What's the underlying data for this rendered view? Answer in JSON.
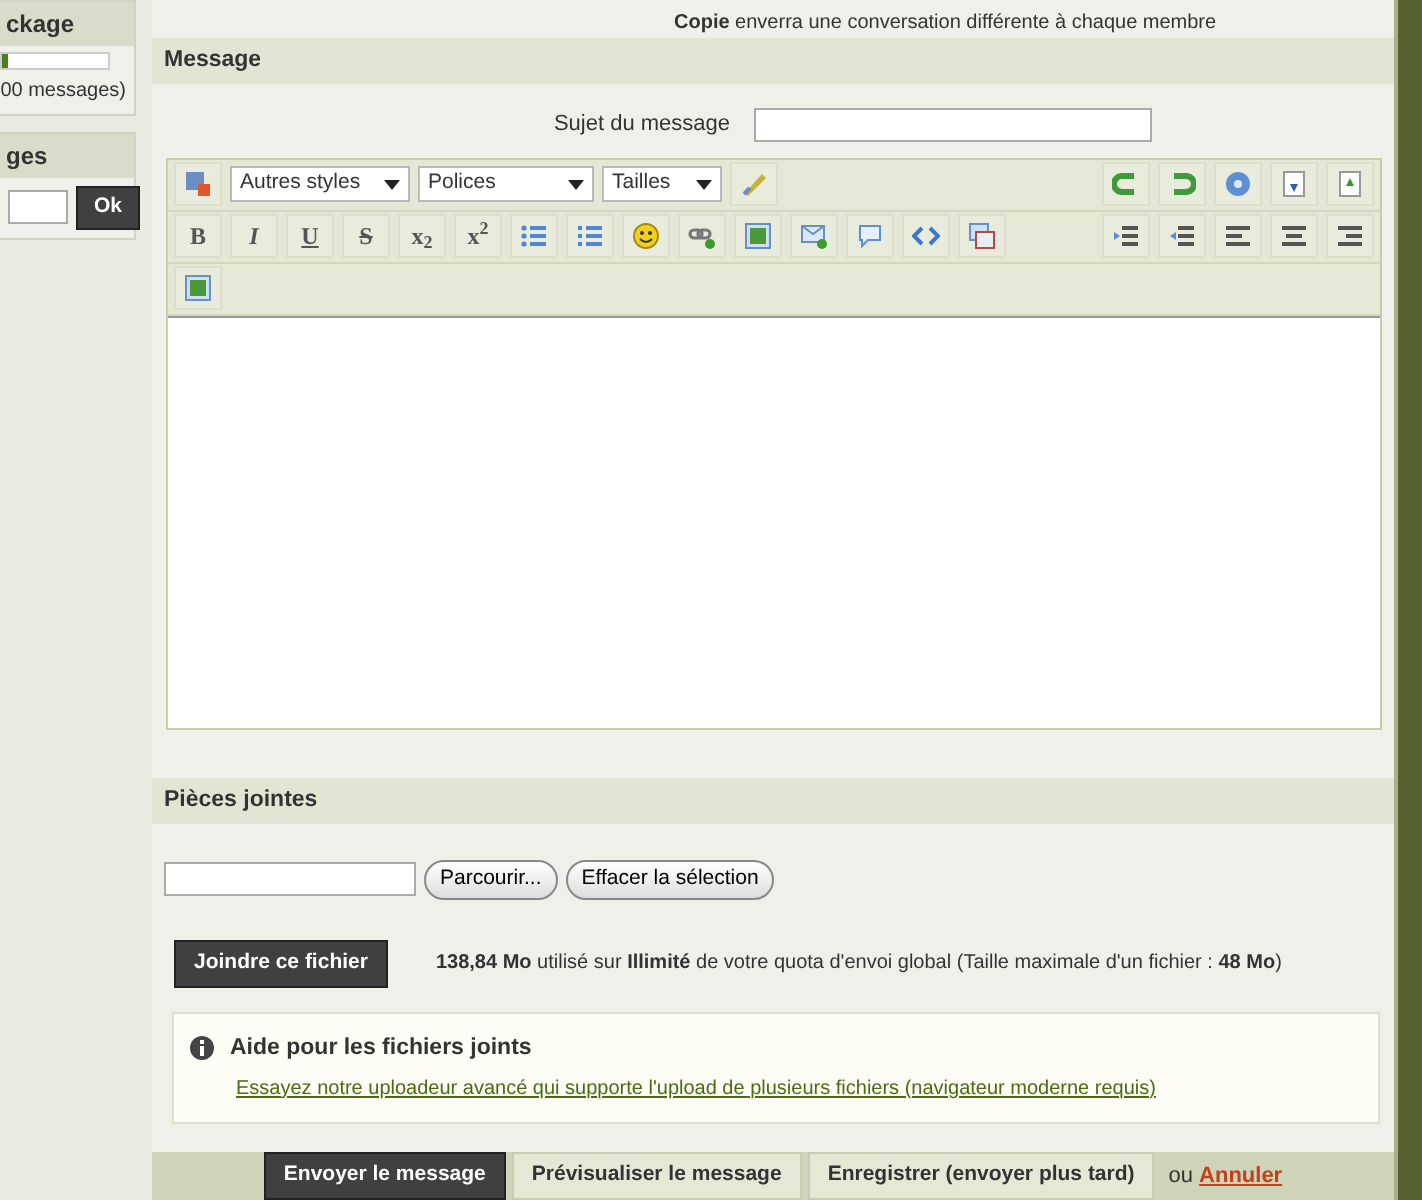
{
  "sidebar": {
    "quota_box": {
      "title": "ckage",
      "level": 0.06,
      "caption": "00 messages)"
    },
    "search_box": {
      "title": "ges",
      "button": "Ok"
    }
  },
  "help_lines": [
    "**Copie** enverra une conversation différente à chaque membre"
  ],
  "message": {
    "title": "Message",
    "subject_label": "Sujet du message"
  },
  "editor": {
    "selects": [
      "Autres styles",
      "Polices",
      "Tailles"
    ],
    "format_buttons": [
      "B",
      "I",
      "U",
      "S",
      "x$_{2}$",
      "x$^{2}$"
    ]
  },
  "attachments": {
    "title": "Pièces jointes",
    "browse_button": "Parcourir...",
    "clear_button": "Effacer la sélection",
    "attach_button": "Joindre ce fichier",
    "quota": "**138,84 Mo** utilisé sur **Illimité** de votre quota d'envoi global (Taille maximale d'un fichier : **48 Mo**)",
    "help": {
      "title": "Aide pour les fichiers joints",
      "link": "Essayez notre uploadeur avancé qui supporte l'upload de plusieurs fichiers (navigateur moderne requis)"
    }
  },
  "footer": {
    "buttons": [
      {
        "label": "Envoyer le message",
        "kind": "primary"
      },
      {
        "label": "Prévisualiser le message",
        "kind": "secondary"
      },
      {
        "label": "Enregistrer (envoyer plus tard)",
        "kind": "secondary"
      }
    ],
    "separator": "ou",
    "cancel_link": "Annuler"
  }
}
